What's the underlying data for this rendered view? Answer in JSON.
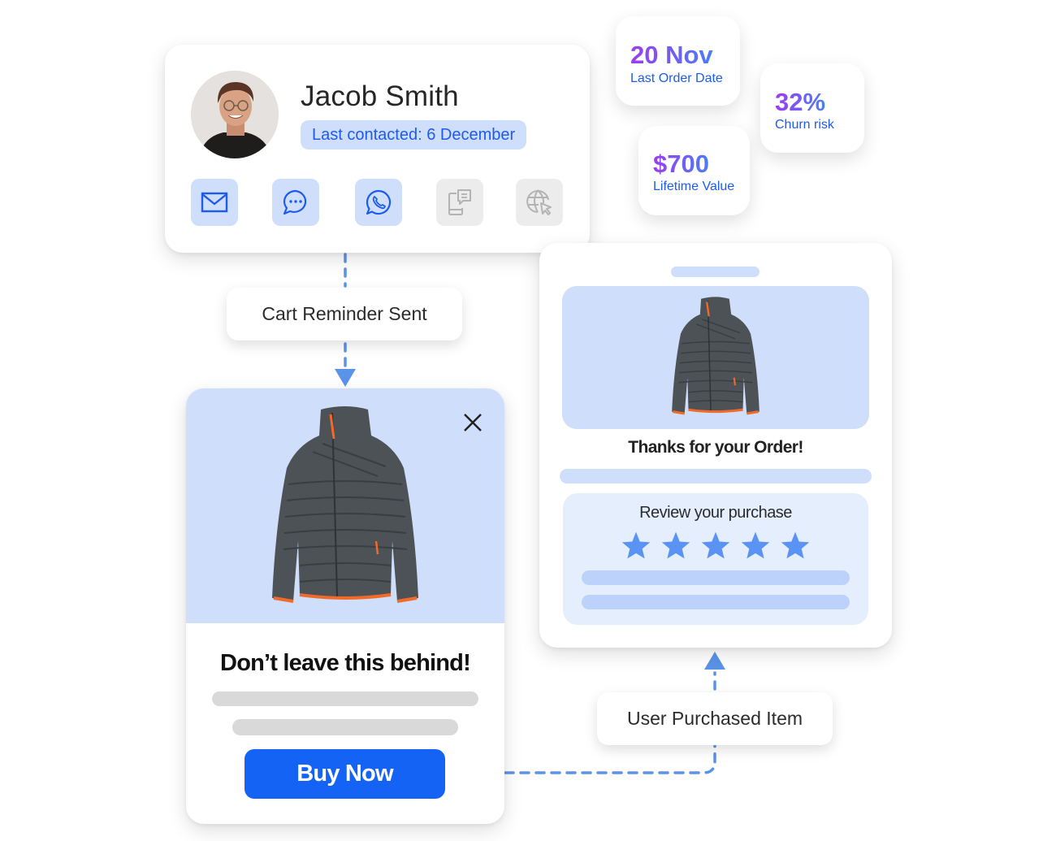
{
  "profile": {
    "name": "Jacob Smith",
    "last_contacted": "Last contacted: 6 December",
    "channels": [
      {
        "name": "email",
        "icon": "mail-icon",
        "active": true
      },
      {
        "name": "chat",
        "icon": "chat-bubble-icon",
        "active": true
      },
      {
        "name": "whatsapp",
        "icon": "whatsapp-icon",
        "active": true
      },
      {
        "name": "sms",
        "icon": "phone-message-icon",
        "active": false
      },
      {
        "name": "web",
        "icon": "globe-cursor-icon",
        "active": false
      }
    ]
  },
  "stats": {
    "last_order": {
      "value": "20 Nov",
      "label": "Last Order Date"
    },
    "churn": {
      "value": "32%",
      "label": "Churn risk"
    },
    "ltv": {
      "value": "$700",
      "label": "Lifetime Value"
    }
  },
  "flow": {
    "step1": "Cart Reminder Sent",
    "step2": "User Purchased Item"
  },
  "popup": {
    "title": "Don’t leave this behind!",
    "cta": "Buy Now",
    "close_icon": "close-icon"
  },
  "order": {
    "title": "Thanks for your Order!",
    "review_title": "Review your purchase",
    "rating": 5,
    "rating_max": 5
  },
  "colors": {
    "accent": "#1463f5",
    "accent_text": "#1d5bf0",
    "light_blue": "#cfdefb",
    "connector": "#5b93e8"
  }
}
